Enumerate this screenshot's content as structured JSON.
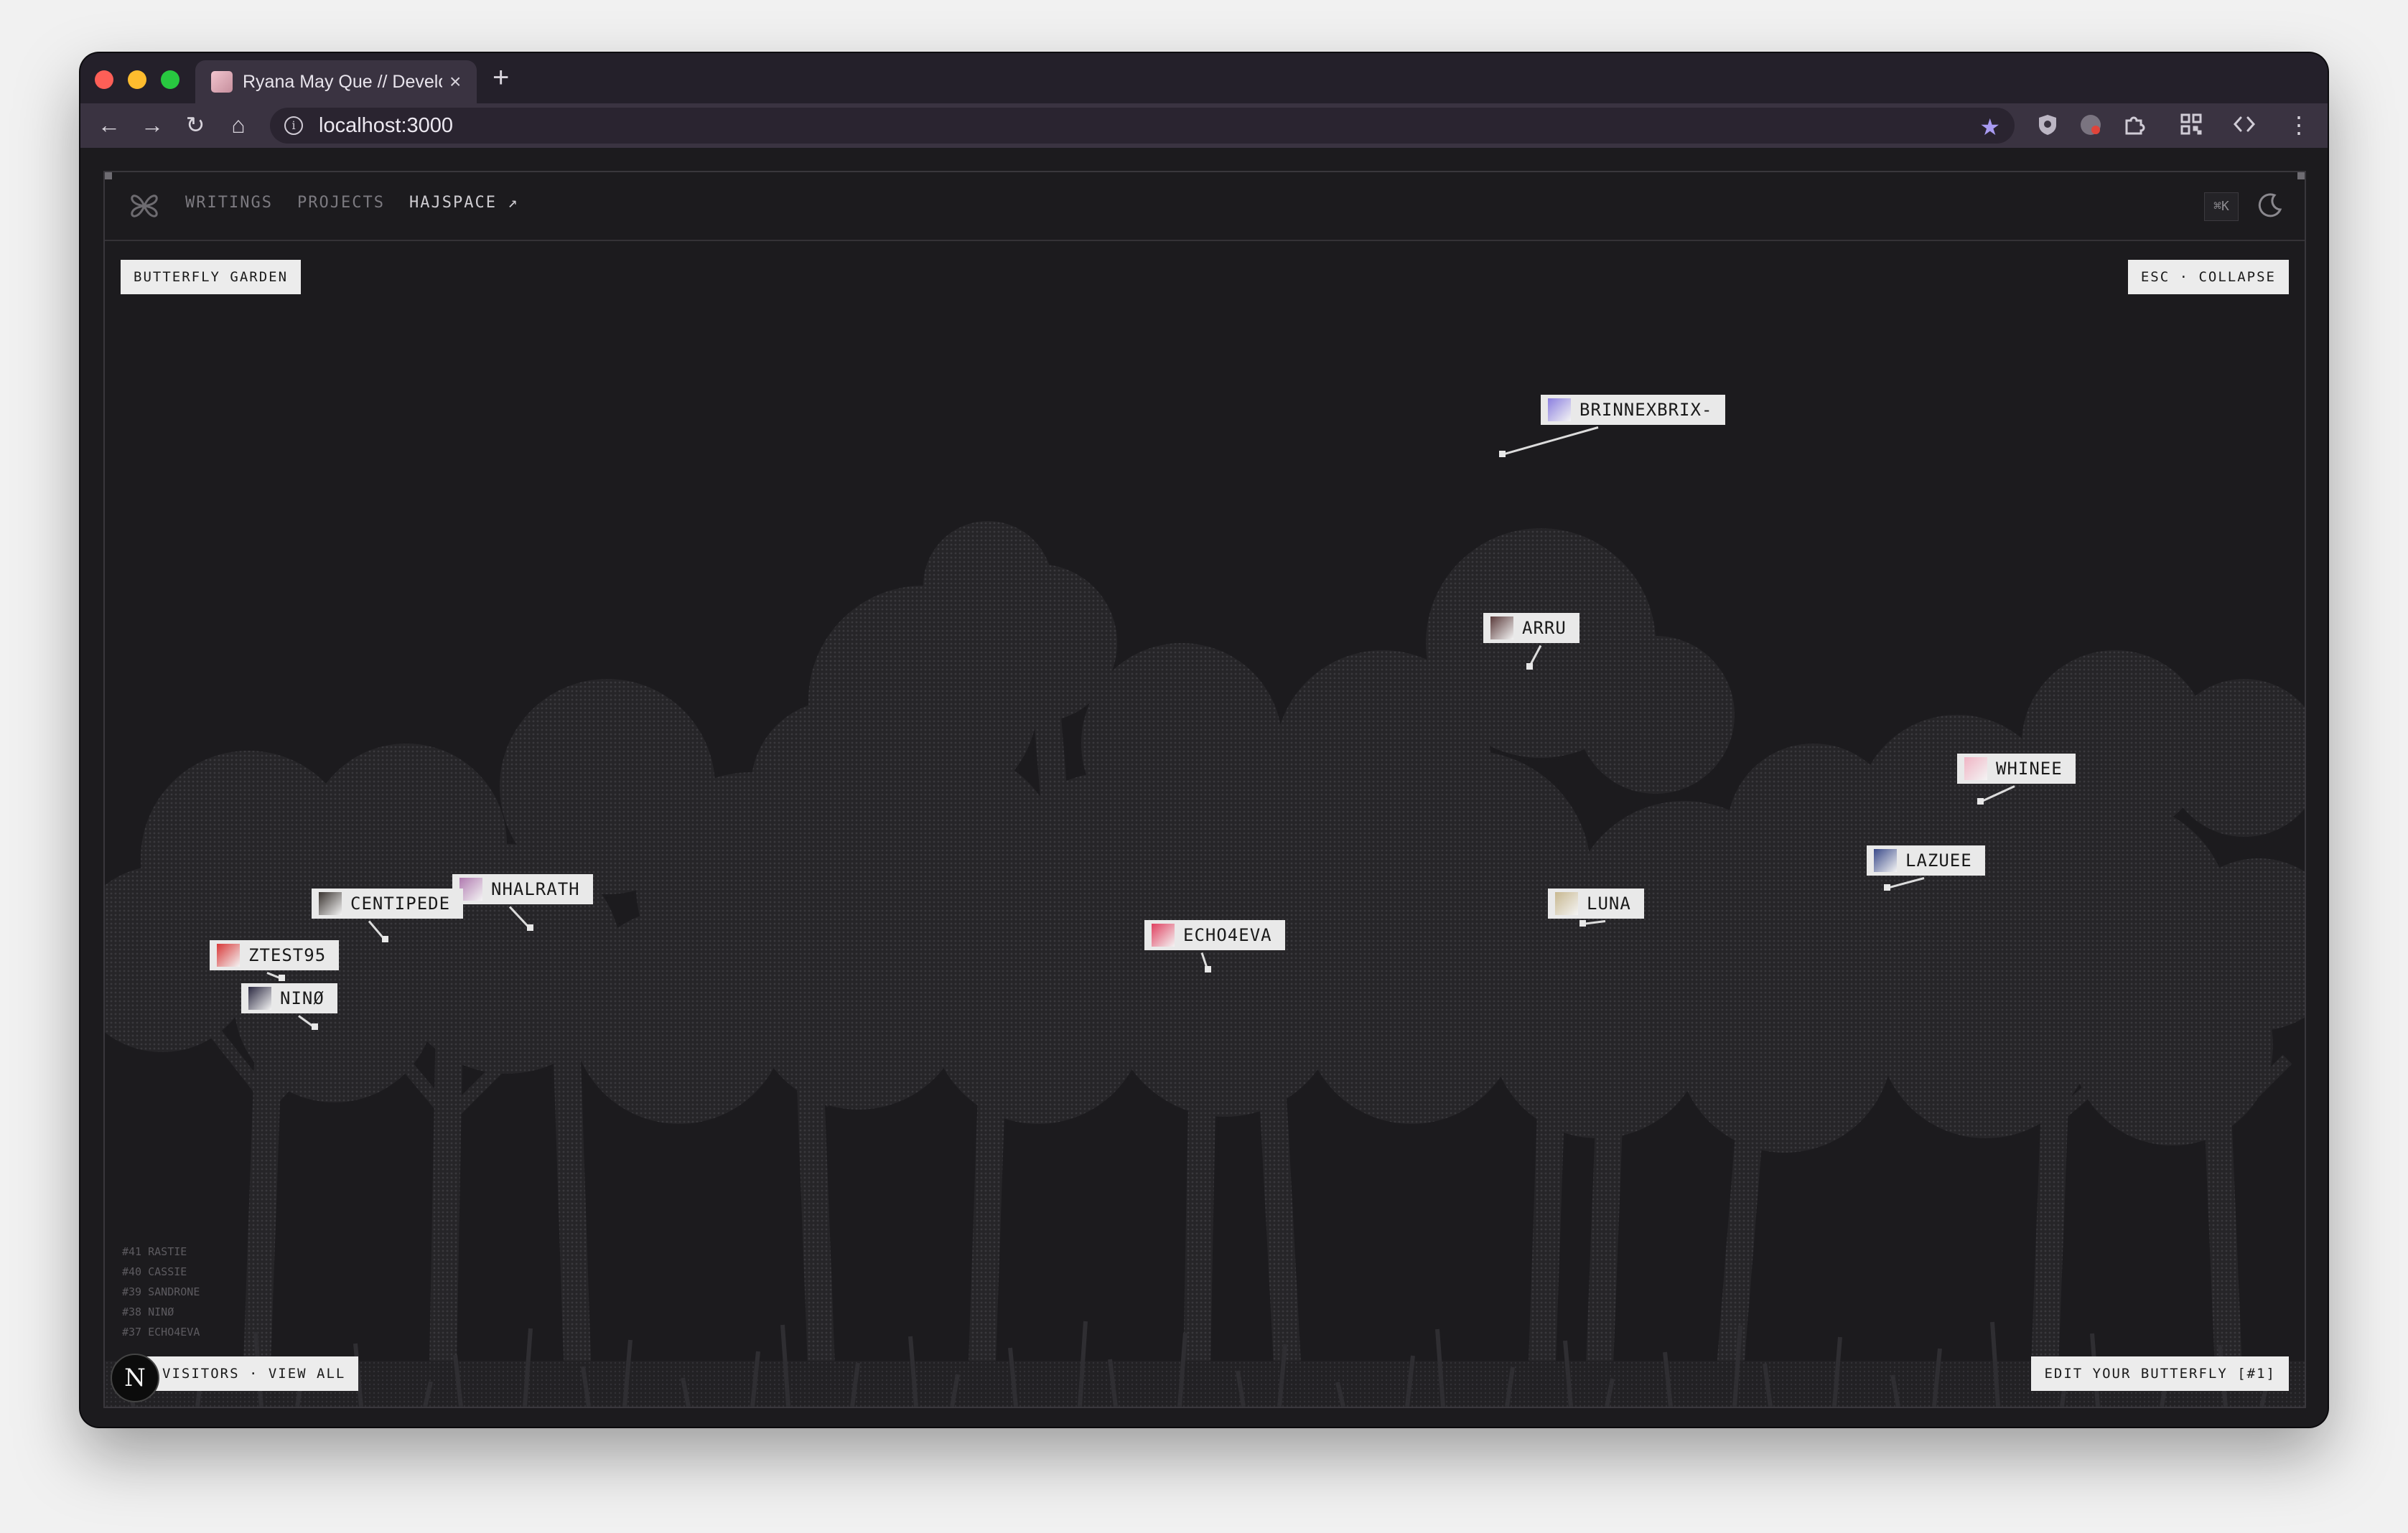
{
  "browser": {
    "tab_title": "Ryana May Que // Develo",
    "tab_close": "×",
    "new_tab": "+",
    "url": "localhost:3000",
    "nav": {
      "back": "←",
      "forward": "→",
      "reload": "↻",
      "home": "⌂"
    },
    "menu": "⋮"
  },
  "site_nav": {
    "links": [
      {
        "label": "WRITINGS"
      },
      {
        "label": "PROJECTS"
      },
      {
        "label": "HAJSPACE ↗"
      }
    ],
    "shortcut": "⌘K"
  },
  "garden": {
    "title": "BUTTERFLY GARDEN",
    "collapse": "ESC · COLLAPSE",
    "visitors_link": "VISITORS · VIEW ALL",
    "edit_button": "EDIT YOUR BUTTERFLY [#1]",
    "badge": "N",
    "recent": [
      "#41 RASTIE",
      "#40 CASSIE",
      "#39 SANDRONE",
      "#38 NINØ",
      "#37 ECHO4EVA"
    ],
    "butterflies": [
      {
        "name": "BRINNEXBRIX-",
        "color": "#8b7fe0"
      },
      {
        "name": "ARRU",
        "color": "#5a3a3a"
      },
      {
        "name": "WHINEE",
        "color": "#f0b4c4"
      },
      {
        "name": "LAZUEE",
        "color": "#3a4a8a"
      },
      {
        "name": "LUNA",
        "color": "#c8b890"
      },
      {
        "name": "ECHO4EVA",
        "color": "#e04060"
      },
      {
        "name": "NHALRATH",
        "color": "#b07ab0"
      },
      {
        "name": "CENTIPEDE",
        "color": "#3a3430"
      },
      {
        "name": "ZTEST95",
        "color": "#d83838"
      },
      {
        "name": "NINØ",
        "color": "#2a2840"
      }
    ]
  }
}
